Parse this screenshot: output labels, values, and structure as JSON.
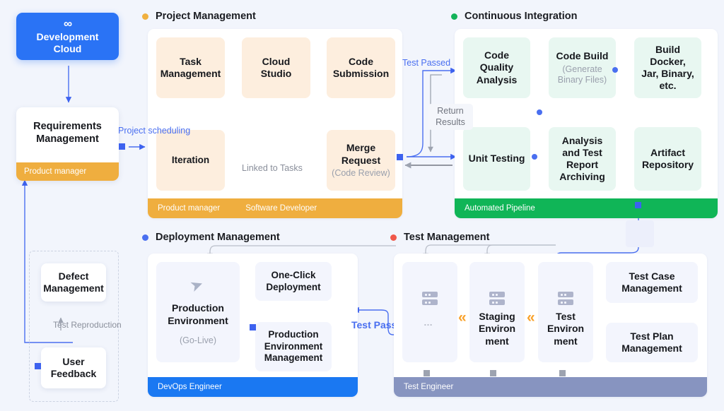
{
  "root": {
    "icon": "infinity-icon",
    "icon_glyph": "∞",
    "title_line1": "Development",
    "title_line2": "Cloud"
  },
  "requirements": {
    "title_line1": "Requirements",
    "title_line2": "Management",
    "role": "Product manager"
  },
  "left_group": {
    "defect_line1": "Defect",
    "defect_line2": "Management",
    "feedback_line1": "User",
    "feedback_line2": "Feedback",
    "edge_label": "Test Reproduction"
  },
  "sections": [
    {
      "id": "project-management",
      "label": "Project Management",
      "dot_color": "#f0b03f",
      "role_bar_color": "#efae3f",
      "roles": [
        "Product manager",
        "Software Developer"
      ]
    },
    {
      "id": "continuous-integration",
      "label": "Continuous Integration",
      "dot_color": "#14b35a",
      "role_bar_color": "#10b557",
      "roles": [
        "Automated Pipeline"
      ]
    },
    {
      "id": "deployment-management",
      "label": "Deployment Management",
      "dot_color": "#4a6ff0",
      "role_bar_color": "#1a78f2",
      "roles": [
        "DevOps Engineer"
      ]
    },
    {
      "id": "test-management",
      "label": "Test Management",
      "dot_color": "#f0584a",
      "role_bar_color": "#8794c0",
      "roles": [
        "Test Engineer"
      ]
    }
  ],
  "project_management": {
    "nodes": [
      {
        "id": "task-management",
        "line1": "Task",
        "line2": "Management",
        "sub": ""
      },
      {
        "id": "cloud-studio",
        "line1": "Cloud",
        "line2": "Studio",
        "sub": ""
      },
      {
        "id": "code-submission",
        "line1": "Code",
        "line2": "Submission",
        "sub": ""
      },
      {
        "id": "iteration",
        "line1": "Iteration",
        "line2": "",
        "sub": ""
      },
      {
        "id": "merge-request",
        "line1": "Merge",
        "line2": "Request",
        "sub": "(Code Review)"
      }
    ],
    "edge_labels": {
      "scheduling": "Project scheduling",
      "linked": "Linked to Tasks"
    }
  },
  "continuous_integration": {
    "nodes": [
      {
        "id": "code-quality-analysis",
        "line1": "Code",
        "line2": "Quality",
        "line3": "Analysis",
        "sub": ""
      },
      {
        "id": "code-build",
        "line1": "Code Build",
        "line2": "",
        "line3": "",
        "sub_line1": "(Generate",
        "sub_line2": "Binary Files)"
      },
      {
        "id": "build-artifacts",
        "line1": "Build",
        "line2": "Docker,",
        "line3": "Jar, Binary,",
        "line4": "etc.",
        "sub": ""
      },
      {
        "id": "unit-testing",
        "line1": "Unit Testing",
        "line2": "",
        "line3": "",
        "sub": ""
      },
      {
        "id": "analysis-report-archiving",
        "line1": "Analysis",
        "line2": "and Test",
        "line3": "Report",
        "line4": "Archiving",
        "sub": ""
      },
      {
        "id": "artifact-repository",
        "line1": "Artifact",
        "line2": "Repository",
        "line3": "",
        "sub": ""
      }
    ],
    "edge_labels": {
      "test_passed": "Test Passed",
      "return_results_line1": "Return",
      "return_results_line2": "Results"
    }
  },
  "deployment_management": {
    "nodes": [
      {
        "id": "production-environment",
        "icon": "send-plane-icon",
        "line1": "Production",
        "line2": "Environment",
        "sub": "(Go-Live)"
      },
      {
        "id": "one-click-deployment",
        "line1": "One-Click",
        "line2": "Deployment",
        "sub": ""
      },
      {
        "id": "production-environment-management",
        "line1": "Production",
        "line2": "Environment",
        "line3": "Management",
        "sub": ""
      }
    ],
    "edge_labels": {
      "test_passed": "Test Passed"
    }
  },
  "test_management": {
    "nodes": [
      {
        "id": "env-more",
        "icon": "server-stack-icon",
        "line1": "",
        "line2": "",
        "ellipsis": "…"
      },
      {
        "id": "staging-environment",
        "icon": "server-stack-icon",
        "line1": "Staging",
        "line2": "Environ",
        "line3": "ment"
      },
      {
        "id": "test-environment",
        "icon": "server-stack-icon",
        "line1": "Test",
        "line2": "Environ",
        "line3": "ment"
      },
      {
        "id": "test-case-management",
        "line1": "Test Case",
        "line2": "Management",
        "line3": ""
      },
      {
        "id": "test-plan-management",
        "line1": "Test Plan",
        "line2": "Management",
        "line3": ""
      }
    ],
    "chevron_glyph": "«"
  },
  "colors": {
    "page_bg": "#f2f5fc",
    "accent_blue": "#3d62ef",
    "accent_orange": "#efae3f",
    "accent_green": "#10b557",
    "accent_red": "#f0584a",
    "node_orange": "#fdeede",
    "node_green": "#e8f7f1",
    "node_violet": "#f3f5fd",
    "line_gray": "#b9bec9"
  }
}
